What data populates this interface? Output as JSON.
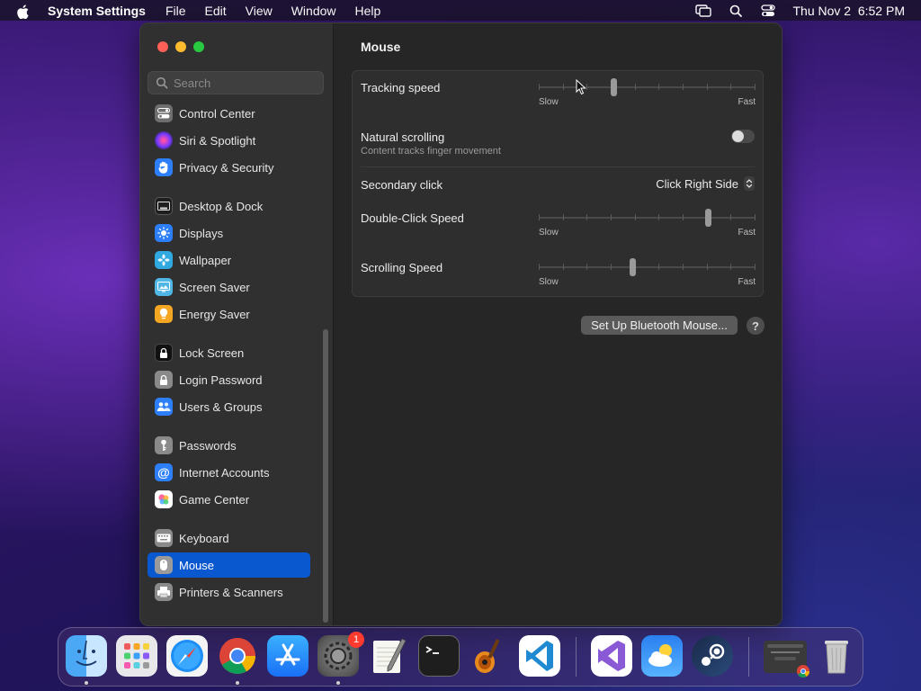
{
  "menubar": {
    "app_name": "System Settings",
    "items": [
      "File",
      "Edit",
      "View",
      "Window",
      "Help"
    ],
    "clock": "Thu Nov 2  6:52 PM"
  },
  "sidebar": {
    "search_placeholder": "Search",
    "items": [
      {
        "label": "Control Center",
        "icon": "control-center-icon",
        "color": "#6e6e6e"
      },
      {
        "label": "Siri & Spotlight",
        "icon": "siri-icon",
        "color": "#b0309a"
      },
      {
        "label": "Privacy & Security",
        "icon": "hand-icon",
        "color": "#2d7ff9"
      },
      {
        "label": "Desktop & Dock",
        "icon": "desktop-dock-icon",
        "color": "#3a3a3a"
      },
      {
        "label": "Displays",
        "icon": "sun-icon",
        "color": "#2d7ff9"
      },
      {
        "label": "Wallpaper",
        "icon": "flower-icon",
        "color": "#30a8e0"
      },
      {
        "label": "Screen Saver",
        "icon": "screen-saver-icon",
        "color": "#4fb6e6"
      },
      {
        "label": "Energy Saver",
        "icon": "bulb-icon",
        "color": "#f5a623"
      },
      {
        "label": "Lock Screen",
        "icon": "lock-icon",
        "color": "#1e1e1e"
      },
      {
        "label": "Login Password",
        "icon": "padlock-icon",
        "color": "#8a8a8a"
      },
      {
        "label": "Users & Groups",
        "icon": "users-icon",
        "color": "#2d7ff9"
      },
      {
        "label": "Passwords",
        "icon": "key-icon",
        "color": "#8a8a8a"
      },
      {
        "label": "Internet Accounts",
        "icon": "at-icon",
        "color": "#2d7ff9"
      },
      {
        "label": "Game Center",
        "icon": "game-center-icon",
        "color": "#ffffff"
      },
      {
        "label": "Keyboard",
        "icon": "keyboard-icon",
        "color": "#8a8a8a"
      },
      {
        "label": "Mouse",
        "icon": "mouse-icon",
        "color": "#8a8a8a"
      },
      {
        "label": "Printers & Scanners",
        "icon": "printer-icon",
        "color": "#8a8a8a"
      }
    ],
    "active": "Mouse"
  },
  "content": {
    "title": "Mouse",
    "tracking_speed": {
      "label": "Tracking speed",
      "min_label": "Slow",
      "max_label": "Fast",
      "value": 0.34
    },
    "natural_scrolling": {
      "label": "Natural scrolling",
      "description": "Content tracks finger movement",
      "enabled": false
    },
    "secondary_click": {
      "label": "Secondary click",
      "value": "Click Right Side"
    },
    "double_click_speed": {
      "label": "Double-Click Speed",
      "min_label": "Slow",
      "max_label": "Fast",
      "value": 0.79
    },
    "scrolling_speed": {
      "label": "Scrolling Speed",
      "min_label": "Slow",
      "max_label": "Fast",
      "value": 0.43
    },
    "bluetooth_button": "Set Up Bluetooth Mouse...",
    "help_button": "?"
  },
  "dock": {
    "apps": [
      {
        "name": "Finder",
        "icon": "finder-icon",
        "running": true
      },
      {
        "name": "Launchpad",
        "icon": "launchpad-icon",
        "running": false
      },
      {
        "name": "Safari",
        "icon": "safari-icon",
        "running": false
      },
      {
        "name": "Chrome",
        "icon": "chrome-icon",
        "running": true
      },
      {
        "name": "App Store",
        "icon": "app-store-icon",
        "running": false
      },
      {
        "name": "System Settings",
        "icon": "system-settings-icon",
        "running": true,
        "badge": "1"
      },
      {
        "name": "TextEdit",
        "icon": "textedit-icon",
        "running": false
      },
      {
        "name": "Terminal",
        "icon": "terminal-icon",
        "running": false
      },
      {
        "name": "GarageBand",
        "icon": "guitar-icon",
        "running": false
      },
      {
        "name": "VS Code",
        "icon": "vscode-icon",
        "running": false
      },
      {
        "name": "Visual Studio",
        "icon": "visual-studio-icon",
        "running": false
      },
      {
        "name": "Weather",
        "icon": "weather-icon",
        "running": false
      },
      {
        "name": "Steam",
        "icon": "steam-icon",
        "running": false
      },
      {
        "name": "Chrome Window",
        "icon": "chrome-window-icon",
        "running": false
      },
      {
        "name": "Trash",
        "icon": "trash-icon",
        "running": false
      }
    ]
  }
}
